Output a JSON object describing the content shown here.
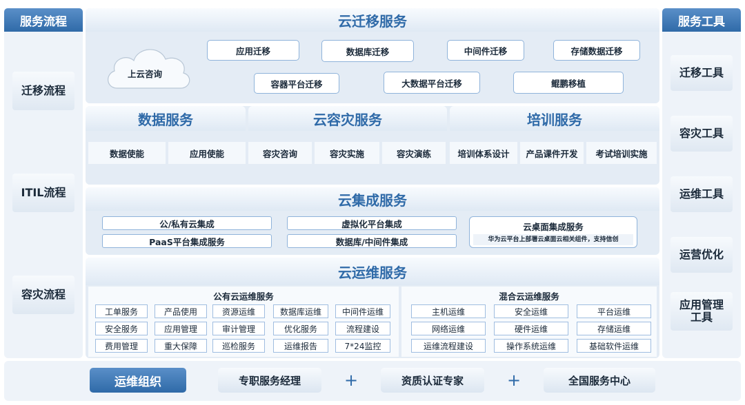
{
  "left": {
    "header": "服务流程",
    "items": [
      "迁移流程",
      "ITIL流程",
      "容灾流程"
    ]
  },
  "right": {
    "header": "服务工具",
    "items": [
      "迁移工具",
      "容灾工具",
      "运维工具",
      "运营优化",
      "应用管理工具"
    ]
  },
  "migration": {
    "title": "云迁移服务",
    "cloud_label": "上云咨询",
    "row1": [
      "应用迁移",
      "数据库迁移",
      "中间件迁移",
      "存储数据迁移"
    ],
    "row2": [
      "容器平台迁移",
      "大数据平台迁移",
      "鲲鹏移植"
    ]
  },
  "middle": {
    "titles": [
      "数据服务",
      "云容灾服务",
      "培训服务"
    ],
    "items": [
      "数据使能",
      "应用使能",
      "容灾咨询",
      "容灾实施",
      "容灾演练",
      "培训体系设计",
      "产品课件开发",
      "考试培训实施"
    ]
  },
  "integration": {
    "title": "云集成服务",
    "left_col": [
      "公/私有云集成",
      "PaaS平台集成服务"
    ],
    "mid_col": [
      "虚拟化平台集成",
      "数据库/中间件集成"
    ],
    "desktop_title": "云桌面集成服务",
    "desktop_note": "华为云平台上部署云桌面云相关组件，支持信创"
  },
  "operations": {
    "title": "云运维服务",
    "public_title": "公有云运维服务",
    "public_items": [
      "工单服务",
      "产品使用",
      "资源运维",
      "数据库运维",
      "中间件运维",
      "安全服务",
      "应用管理",
      "审计管理",
      "优化服务",
      "流程建设",
      "费用管理",
      "重大保障",
      "巡检服务",
      "运维报告",
      "7*24监控"
    ],
    "hybrid_title": "混合云运维服务",
    "hybrid_items": [
      "主机运维",
      "安全运维",
      "平台运维",
      "网络运维",
      "硬件运维",
      "存储运维",
      "运维流程建设",
      "操作系统运维",
      "基础软件运维"
    ]
  },
  "bottom": {
    "org_label": "运维组织",
    "items": [
      "专职服务经理",
      "资质认证专家",
      "全国服务中心"
    ],
    "plus": "+"
  },
  "colors": {
    "accent": "#2f6aa8",
    "panel": "#eef3f9",
    "border": "#8fb3da"
  }
}
